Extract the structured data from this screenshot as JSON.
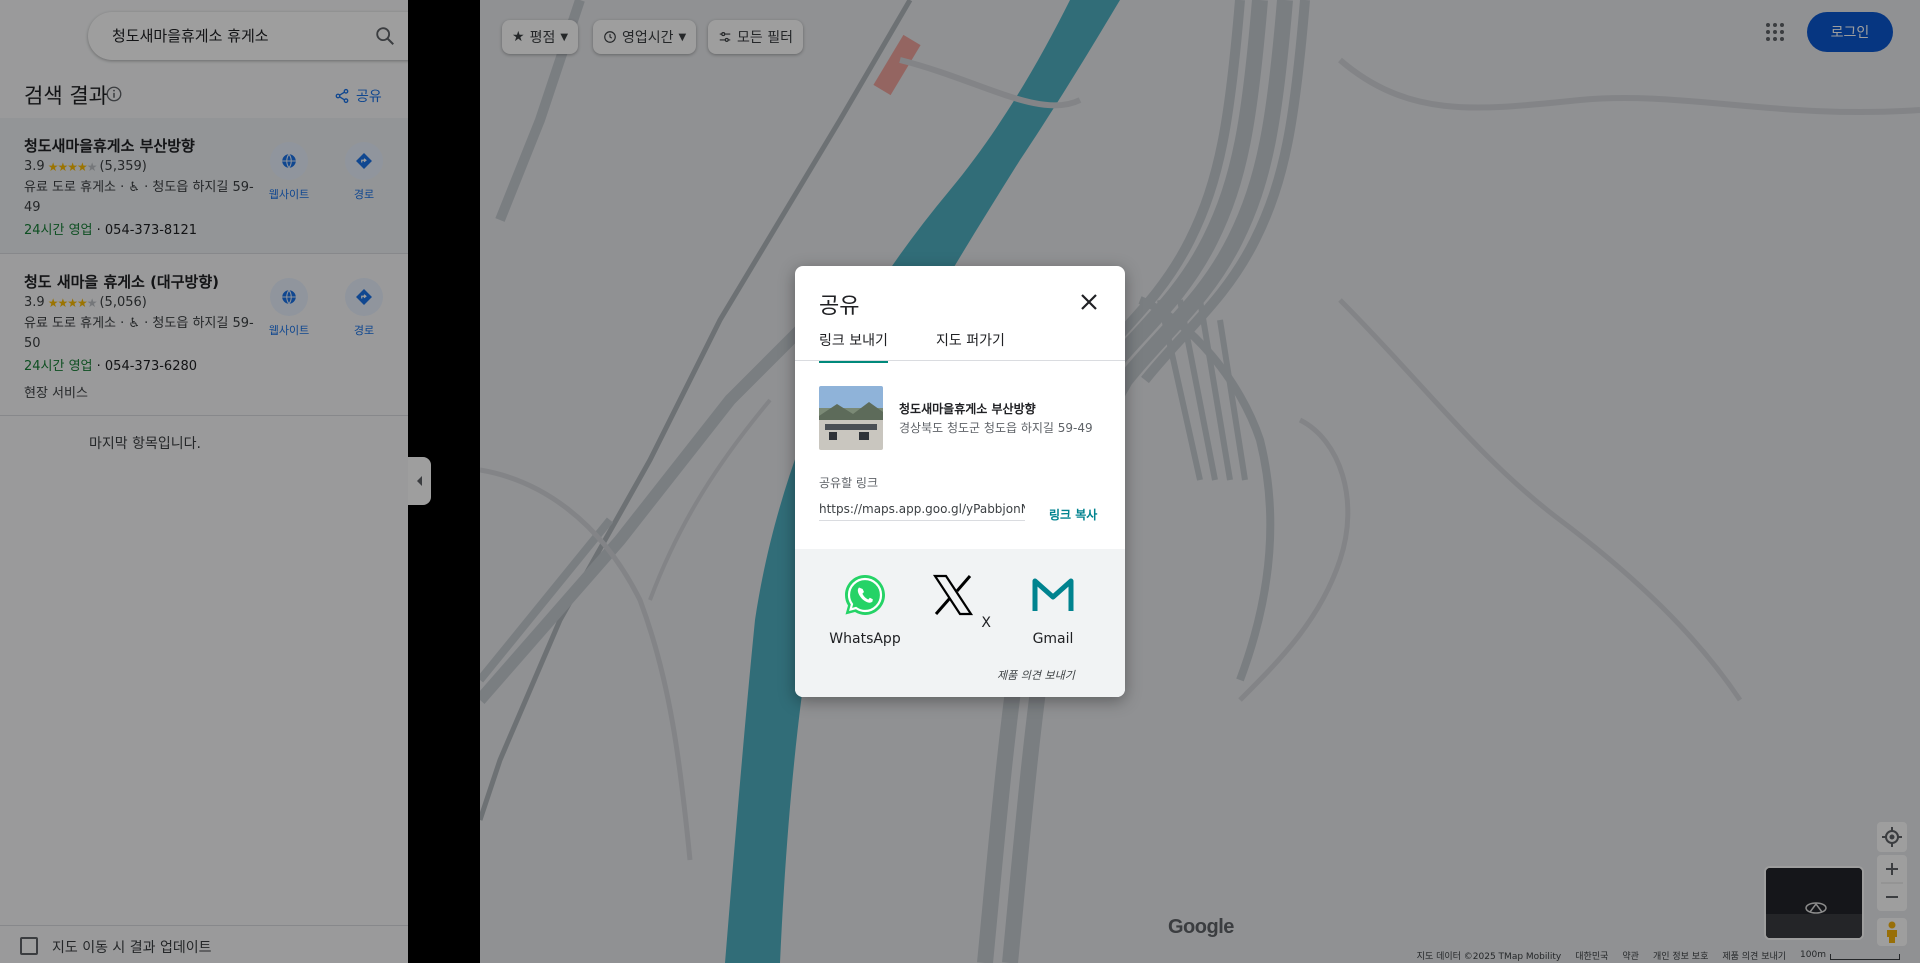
{
  "search": {
    "value": "청도새마을휴게소 휴게소"
  },
  "results_header": {
    "title": "검색 결과",
    "share_label": "공유"
  },
  "results": [
    {
      "name": "청도새마을휴게소 부산방향",
      "rating": "3.9",
      "reviews": "(5,359)",
      "line1": "유료 도로 휴게소 · ♿ · 청도읍 하지길 59-49",
      "hours_status": "24시간 영업",
      "phone": " · 054-373-8121",
      "website_label": "웹사이트",
      "directions_label": "경로"
    },
    {
      "name": "청도 새마을 휴게소 (대구방향)",
      "rating": "3.9",
      "reviews": "(5,056)",
      "line1": "유료 도로 휴게소 · ♿ · 청도읍 하지길 59-50",
      "hours_status": "24시간 영업",
      "phone": " · 054-373-6280",
      "service": "현장 서비스",
      "website_label": "웹사이트",
      "directions_label": "경로"
    }
  ],
  "end_of_list": "마지막 항목입니다.",
  "update_on_move": "지도 이동 시 결과 업데이트",
  "map": {
    "filters": [
      "평점",
      "영업시간",
      "모든 필터"
    ],
    "login_label": "로그인",
    "logo_text": "Google",
    "attribution": [
      "지도 데이터 ©2025 TMap Mobility",
      "대한민국",
      "약관",
      "개인 정보 보호",
      "제품 의견 보내기"
    ],
    "scale_label": "100m"
  },
  "dialog": {
    "title": "공유",
    "tabs": [
      "링크 보내기",
      "지도 퍼가기"
    ],
    "place_name": "청도새마을휴게소 부산방향",
    "place_address": "경상북도 청도군 청도읍 하지길 59-49",
    "link_label": "공유할 링크",
    "link_value": "https://maps.app.goo.gl/yPabbjonN",
    "copy_label": "링크 복사",
    "targets": [
      "WhatsApp",
      "X",
      "Gmail"
    ],
    "feedback": "제품 의견 보내기"
  },
  "colors": {
    "accent": "#1a73e8",
    "teal": "#00897b",
    "login": "#0b57d0",
    "open": "#188038"
  }
}
